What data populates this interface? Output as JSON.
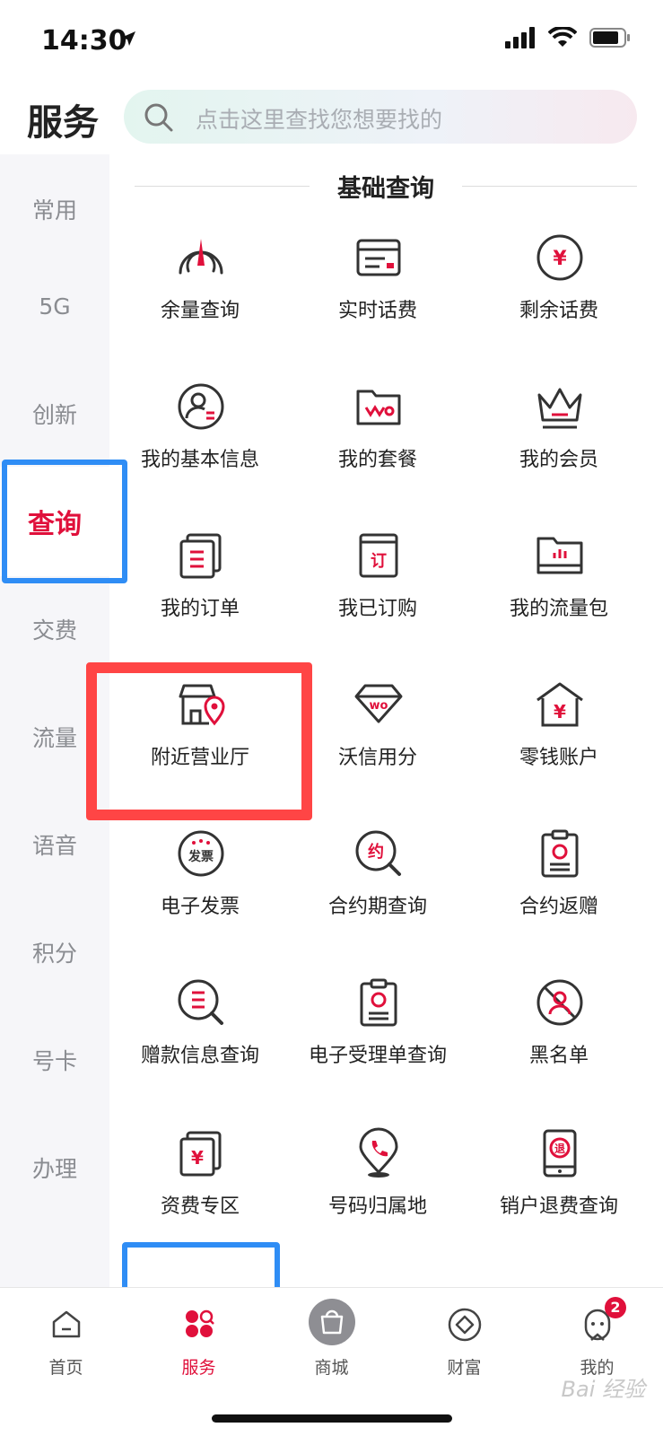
{
  "status": {
    "time": "14:30"
  },
  "header": {
    "title": "服务",
    "search_placeholder": "点击这里查找您想要找的"
  },
  "sidebar": {
    "items": [
      "常用",
      "5G",
      "创新",
      "查询",
      "交费",
      "流量",
      "语音",
      "积分",
      "号卡",
      "办理"
    ],
    "active": "查询"
  },
  "section": {
    "title": "基础查询"
  },
  "grid": [
    {
      "label": "余量查询",
      "icon": "gauge-icon"
    },
    {
      "label": "实时话费",
      "icon": "bill-icon"
    },
    {
      "label": "剩余话费",
      "icon": "yuan-circle-icon"
    },
    {
      "label": "我的基本信息",
      "icon": "user-info-icon"
    },
    {
      "label": "我的套餐",
      "icon": "folder-wo-icon"
    },
    {
      "label": "我的会员",
      "icon": "crown-icon"
    },
    {
      "label": "我的订单",
      "icon": "order-list-icon"
    },
    {
      "label": "我已订购",
      "icon": "subscribed-icon"
    },
    {
      "label": "我的流量包",
      "icon": "data-pack-icon"
    },
    {
      "label": "附近营业厅",
      "icon": "store-location-icon"
    },
    {
      "label": "沃信用分",
      "icon": "diamond-wo-icon"
    },
    {
      "label": "零钱账户",
      "icon": "house-yuan-icon"
    },
    {
      "label": "电子发票",
      "icon": "invoice-icon"
    },
    {
      "label": "合约期查询",
      "icon": "contract-search-icon"
    },
    {
      "label": "合约返赠",
      "icon": "contract-gift-icon"
    },
    {
      "label": "赠款信息查询",
      "icon": "grant-search-icon"
    },
    {
      "label": "电子受理单查询",
      "icon": "e-receipt-icon"
    },
    {
      "label": "黑名单",
      "icon": "blacklist-icon"
    },
    {
      "label": "资费专区",
      "icon": "tariff-icon"
    },
    {
      "label": "号码归属地",
      "icon": "phone-location-icon"
    },
    {
      "label": "销户退费查询",
      "icon": "refund-icon"
    }
  ],
  "icon_labels": {
    "invoice": "发票",
    "contract": "约",
    "subscribed": "订",
    "wo": "wo",
    "yuan": "¥",
    "refund": "退"
  },
  "tabs": [
    {
      "label": "首页",
      "icon": "home-icon"
    },
    {
      "label": "服务",
      "icon": "service-icon"
    },
    {
      "label": "商城",
      "icon": "shopping-bag-icon"
    },
    {
      "label": "财富",
      "icon": "wealth-icon"
    },
    {
      "label": "我的",
      "icon": "profile-icon",
      "badge": "2"
    }
  ],
  "active_tab": "服务",
  "watermark": "Bai 经验",
  "colors": {
    "accent": "#e0103b",
    "annotation_blue": "#2f8df5",
    "annotation_red": "#ff4545"
  }
}
